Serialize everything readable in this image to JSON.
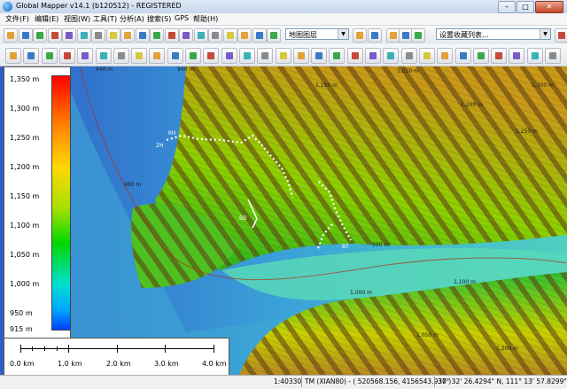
{
  "window": {
    "title": "Global Mapper v14.1 (b120512) - REGISTERED",
    "minimize": "–",
    "maximize": "□",
    "close": "✕"
  },
  "menu": [
    "文件(F)",
    "编辑(E)",
    "视图(W)",
    "工具(T)",
    "分析(A)",
    "搜索(S)",
    "GPS",
    "帮助(H)"
  ],
  "toolbar": {
    "layer_combo": "地图图层",
    "bookmark_combo": "设置收藏列表..."
  },
  "icons_tb1": [
    "open-icon",
    "save-icon",
    "print-icon",
    "config-icon",
    "zoom-in-icon",
    "zoom-out-icon",
    "globe-icon",
    "layers-icon",
    "home-icon",
    "measure-icon",
    "digitize-icon",
    "edit-icon",
    "vertex-icon",
    "image-icon",
    "path-icon",
    "texture-icon",
    "3d-view-icon",
    "hand-icon",
    "binoculars-icon"
  ],
  "icons_tb1b": [
    "bookmark-icon",
    "sun-icon",
    "arrow-icon",
    "flag-icon",
    "route-icon",
    "play-icon"
  ],
  "icons_tb2": [
    "draw-line-icon",
    "edit-feature-icon",
    "vertex-move-icon",
    "shape-icon",
    "feature-info-icon",
    "path-profile-icon",
    "label-icon",
    "area-icon",
    "line-tool-icon",
    "contour-icon",
    "buffer-icon",
    "split-icon",
    "merge-icon",
    "rotate-icon",
    "scale-icon",
    "union-icon",
    "cut-icon",
    "intersect-icon",
    "simplify-icon",
    "smooth-icon",
    "reshape-icon",
    "join-icon",
    "density-icon",
    "delete-icon",
    "undo-icon",
    "redo-icon",
    "move-icon",
    "snap-icon",
    "grid-icon",
    "move-vertex-icon",
    "node-icon"
  ],
  "legend": {
    "labels": [
      "1,350 m",
      "1,300 m",
      "1,250 m",
      "1,200 m",
      "1,150 m",
      "1,100 m",
      "1,050 m",
      "1,000 m",
      "950 m",
      "915 m"
    ],
    "colors": [
      "#ff0000",
      "#ff7a00",
      "#ffd800",
      "#a8e000",
      "#00d800",
      "#00e0d0",
      "#00a8ff",
      "#0040ff"
    ]
  },
  "scale": {
    "labels": [
      "0.0 km",
      "1.0 km",
      "2.0 km",
      "3.0 km",
      "4.0 km"
    ]
  },
  "map_labels": [
    "940 m",
    "940 m",
    "1,050 m",
    "1,150 m",
    "1,200 m",
    "1,250 m",
    "1,000 m",
    "1,100 m",
    "980 m",
    "990 m",
    "1,050 m",
    "1,200 m",
    "1,300 m",
    "ZH",
    "KH",
    "BB",
    "BT"
  ],
  "status": {
    "scale": "1:40330",
    "projection": "TM (XIAN80) - ( 520568.156, 4156543.930 )",
    "latlon": "37° 32' 26.4294\" N, 111° 13' 57.8299\" E"
  }
}
